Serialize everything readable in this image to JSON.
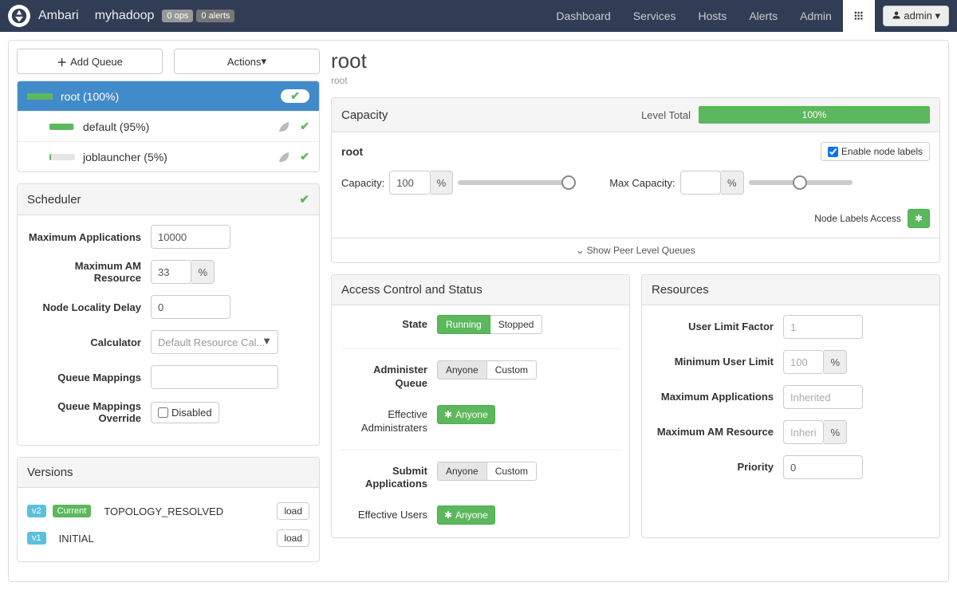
{
  "nav": {
    "brand": "Ambari",
    "cluster": "myhadoop",
    "ops_badge": "0 ops",
    "alerts_badge": "0 alerts",
    "links": [
      "Dashboard",
      "Services",
      "Hosts",
      "Alerts",
      "Admin"
    ],
    "admin_label": "admin"
  },
  "left": {
    "add_queue": "Add Queue",
    "actions": "Actions",
    "queues": [
      {
        "name": "root (100%)",
        "fill": 100,
        "active": true
      },
      {
        "name": "default (95%)",
        "fill": 95,
        "active": false
      },
      {
        "name": "joblauncher (5%)",
        "fill": 5,
        "active": false
      }
    ],
    "scheduler": {
      "title": "Scheduler",
      "max_apps_label": "Maximum Applications",
      "max_apps": "10000",
      "max_am_label": "Maximum AM Resource",
      "max_am": "33",
      "node_locality_label": "Node Locality Delay",
      "node_locality": "0",
      "calculator_label": "Calculator",
      "calculator": "Default Resource Cal...",
      "queue_map_label": "Queue Mappings",
      "queue_map": "",
      "queue_map_ovr_label": "Queue Mappings Override",
      "disabled": "Disabled"
    },
    "versions": {
      "title": "Versions",
      "rows": [
        {
          "tag": "v2",
          "current": "Current",
          "name": "TOPOLOGY_RESOLVED",
          "action": "load"
        },
        {
          "tag": "v1",
          "current": "",
          "name": "INITIAL",
          "action": "load"
        }
      ]
    }
  },
  "right": {
    "title": "root",
    "path": "root",
    "capacity": {
      "title": "Capacity",
      "level_total_label": "Level Total",
      "level_total_pct": "100%",
      "subqueue": "root",
      "enable_node_labels": "Enable node labels",
      "cap_label": "Capacity:",
      "cap_value": "100",
      "maxcap_label": "Max Capacity:",
      "maxcap_value": "",
      "node_labels_access": "Node Labels Access",
      "peer": "Show Peer Level Queues"
    },
    "acl": {
      "title": "Access Control and Status",
      "state_label": "State",
      "running": "Running",
      "stopped": "Stopped",
      "admin_q_label": "Administer Queue",
      "anyone": "Anyone",
      "custom": "Custom",
      "eff_admin_label": "Effective Administraters",
      "anyone_btn": "Anyone",
      "submit_label": "Submit Applications",
      "eff_users_label": "Effective Users"
    },
    "resources": {
      "title": "Resources",
      "user_limit_factor_label": "User Limit Factor",
      "user_limit_factor": "1",
      "min_user_limit_label": "Minimum User Limit",
      "min_user_limit": "100",
      "max_apps_label": "Maximum Applications",
      "max_apps_ph": "Inherited",
      "max_am_label": "Maximum AM Resource",
      "max_am_ph": "Inherited",
      "priority_label": "Priority",
      "priority": "0"
    }
  }
}
